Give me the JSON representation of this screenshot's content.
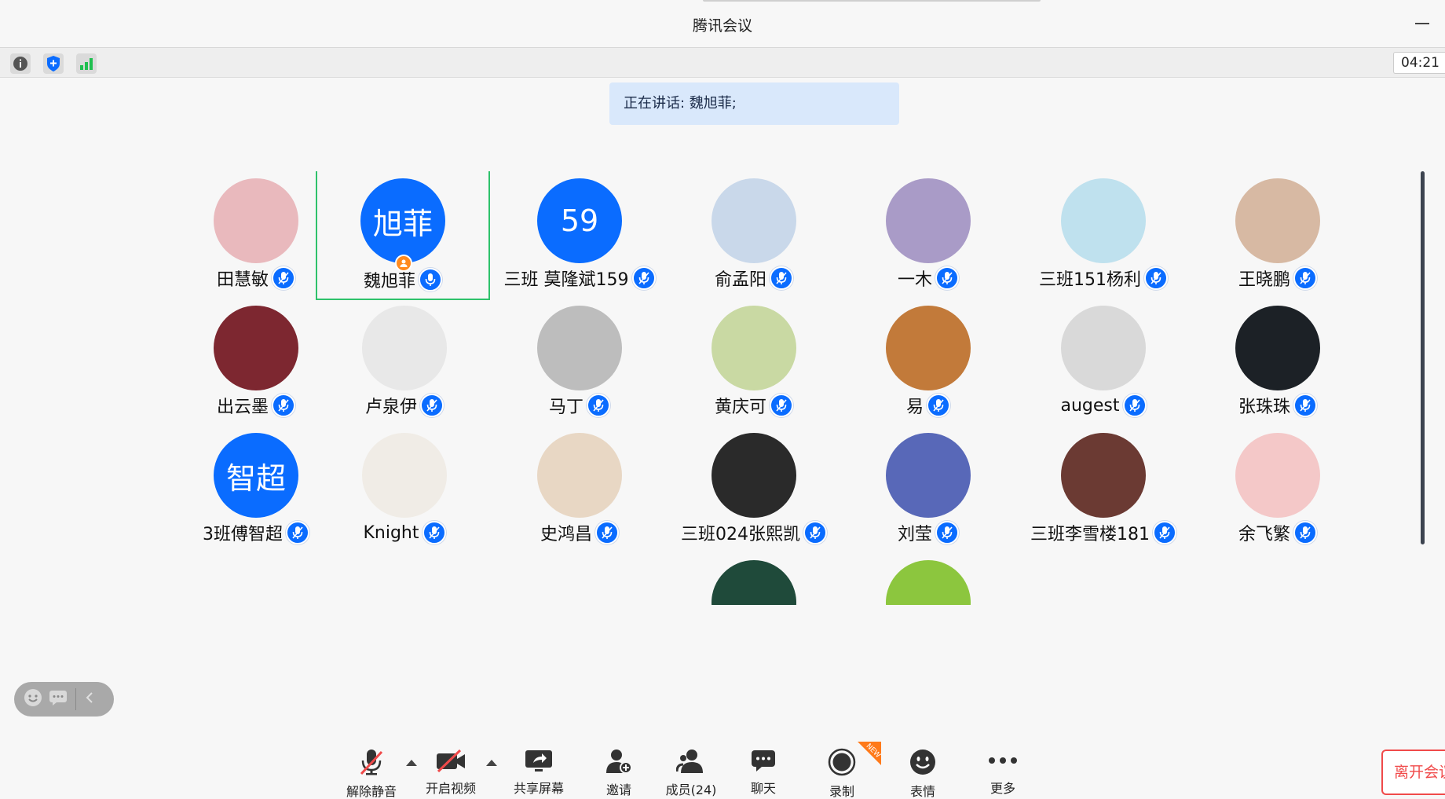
{
  "window": {
    "title": "腾讯会议"
  },
  "status": {
    "clock": "04:21",
    "icons": [
      "info-icon",
      "shield-icon",
      "signal-icon"
    ]
  },
  "speaking": {
    "text": "正在讲话: 魏旭菲;"
  },
  "participants": [
    {
      "name": "田慧敏",
      "avatar_color": "#e9b9bd",
      "initials": ""
    },
    {
      "name": "魏旭菲",
      "avatar_color": "#0a6cff",
      "initials": "旭菲",
      "active": true
    },
    {
      "name": "三班 莫隆斌159",
      "avatar_color": "#0a6cff",
      "initials": "59"
    },
    {
      "name": "俞孟阳",
      "avatar_color": "#c9d8ea",
      "initials": ""
    },
    {
      "name": "一木",
      "avatar_color": "#a99bc7",
      "initials": ""
    },
    {
      "name": "三班151杨利",
      "avatar_color": "#bfe1ee",
      "initials": ""
    },
    {
      "name": "王晓鹏",
      "avatar_color": "#d7b9a3",
      "initials": ""
    },
    {
      "name": "出云墨",
      "avatar_color": "#7d2730",
      "initials": ""
    },
    {
      "name": "卢泉伊",
      "avatar_color": "#e8e8e8",
      "initials": ""
    },
    {
      "name": "马丁",
      "avatar_color": "#bdbdbd",
      "initials": ""
    },
    {
      "name": "黄庆可",
      "avatar_color": "#c9d9a3",
      "initials": ""
    },
    {
      "name": "易",
      "avatar_color": "#c27a3a",
      "initials": ""
    },
    {
      "name": "augest",
      "avatar_color": "#d9d9d9",
      "initials": ""
    },
    {
      "name": "张珠珠",
      "avatar_color": "#1c2126",
      "initials": ""
    },
    {
      "name": "3班傅智超",
      "avatar_color": "#0a6cff",
      "initials": "智超"
    },
    {
      "name": "Knight",
      "avatar_color": "#f0ece6",
      "initials": ""
    },
    {
      "name": "史鸿昌",
      "avatar_color": "#e8d7c4",
      "initials": ""
    },
    {
      "name": "三班024张熙凯",
      "avatar_color": "#2a2a2a",
      "initials": ""
    },
    {
      "name": "刘莹",
      "avatar_color": "#5868b8",
      "initials": ""
    },
    {
      "name": "三班李雪楼181",
      "avatar_color": "#6b3a33",
      "initials": ""
    },
    {
      "name": "余飞繁",
      "avatar_color": "#f4c8c8",
      "initials": ""
    },
    {
      "name": "",
      "avatar_color": "#f7f7f7",
      "initials": ""
    },
    {
      "name": "",
      "avatar_color": "#1f4a3a",
      "initials": ""
    },
    {
      "name": "",
      "avatar_color": "#8cc63e",
      "initials": ""
    }
  ],
  "toolbar": {
    "unmute": "解除静音",
    "start_video": "开启视频",
    "share_screen": "共享屏幕",
    "invite": "邀请",
    "members": "成员(24)",
    "chat": "聊天",
    "record": "录制",
    "reactions": "表情",
    "more": "更多",
    "leave": "离开会议",
    "new_tag": "NEW"
  },
  "colors": {
    "accent": "#0a6cff",
    "active_border": "#2ec26b",
    "leave": "#f04a4a"
  }
}
